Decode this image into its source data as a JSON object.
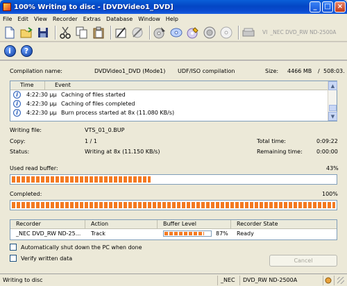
{
  "window": {
    "title": "100% Writing to disc - [DVDVideo1_DVD]",
    "minimize_glyph": "_",
    "maximize_glyph": "□",
    "close_glyph": "×"
  },
  "menu": [
    "File",
    "Edit",
    "View",
    "Recorder",
    "Extras",
    "Database",
    "Window",
    "Help"
  ],
  "toolbar": {
    "icons": [
      "new-icon",
      "open-icon",
      "save-icon",
      "cut-icon",
      "copy-icon",
      "paste-icon",
      "properties-icon",
      "erase-icon",
      "burn-icon",
      "cd-icon",
      "disc-edit-icon",
      "eject-icon",
      "disc-blank-icon",
      "recorder-icon"
    ],
    "recorder_name": "_NEC     DVD_RW ND-2500A",
    "drive_letter": "VI",
    "info_glyph": "i",
    "help_glyph": "?"
  },
  "compilation": {
    "label": "Compilation name:",
    "name": "DVDVideo1_DVD (Mode1)",
    "format": "UDF/ISO compilation",
    "size_label": "Size:",
    "size_value": "4466 MB",
    "size_sep": "/",
    "size_extra": "508:03."
  },
  "events": {
    "col_time": "Time",
    "col_event": "Event",
    "rows": [
      {
        "time": "4:22:30 μμ",
        "event": "Caching of files started"
      },
      {
        "time": "4:22:30 μμ",
        "event": "Caching of files completed"
      },
      {
        "time": "4:22:30 μμ",
        "event": "Burn process started at 8x (11.080 KB/s)"
      }
    ],
    "scroll_up": "▲",
    "scroll_down": "▼"
  },
  "details": {
    "writing_file_label": "Writing file:",
    "writing_file_value": "VTS_01_0.BUP",
    "copy_label": "Copy:",
    "copy_value": "1 / 1",
    "status_label": "Status:",
    "status_value": "Writing at 8x (11.150 KB/s)",
    "total_time_label": "Total time:",
    "total_time_value": "0:09:22",
    "remaining_label": "Remaining time:",
    "remaining_value": "0:00:00"
  },
  "buffer": {
    "label": "Used read buffer:",
    "percent_text": "43%",
    "fraction": 0.43
  },
  "completed": {
    "label": "Completed:",
    "percent_text": "100%",
    "fraction": 1.0
  },
  "recorders": {
    "col_recorder": "Recorder",
    "col_action": "Action",
    "col_buffer": "Buffer Level",
    "col_state": "Recorder State",
    "row": {
      "recorder": "_NEC DVD_RW ND-25...",
      "action": "Track",
      "buffer_text": "87%",
      "buffer_fraction": 0.87,
      "state": "Ready"
    }
  },
  "options": {
    "auto_shutdown": "Automatically shut down the PC when done",
    "verify": "Verify written data",
    "cancel": "Cancel"
  },
  "statusbar": {
    "text": "Writing to disc",
    "recorder_vendor": "_NEC",
    "recorder_model": "DVD_RW ND-2500A"
  }
}
